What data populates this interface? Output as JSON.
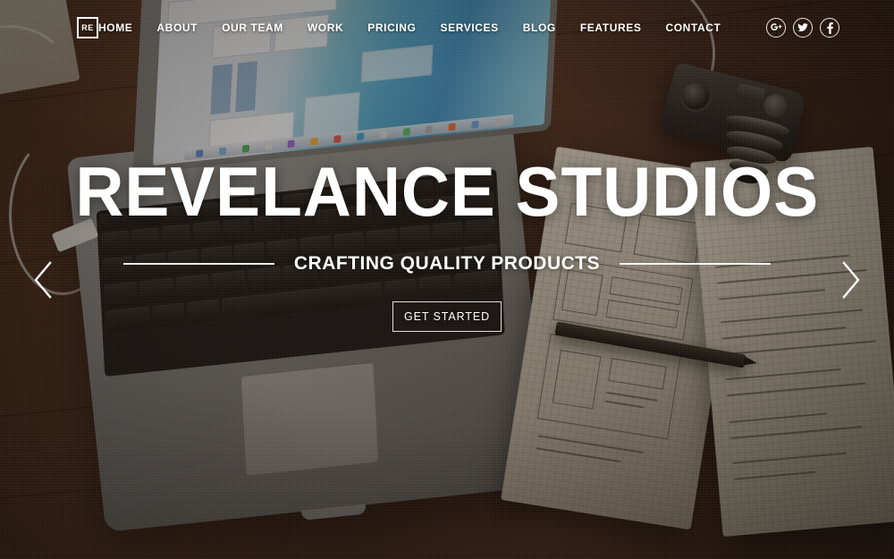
{
  "site": {
    "logo_text": "RE",
    "logo_name": "revelance-logo"
  },
  "nav": {
    "items": [
      {
        "label": "HOME",
        "name": "nav-home"
      },
      {
        "label": "ABOUT",
        "name": "nav-about"
      },
      {
        "label": "OUR TEAM",
        "name": "nav-our-team"
      },
      {
        "label": "WORK",
        "name": "nav-work"
      },
      {
        "label": "PRICING",
        "name": "nav-pricing"
      },
      {
        "label": "SERVICES",
        "name": "nav-services"
      },
      {
        "label": "BLOG",
        "name": "nav-blog"
      },
      {
        "label": "FEATURES",
        "name": "nav-features"
      },
      {
        "label": "CONTACT",
        "name": "nav-contact"
      }
    ]
  },
  "social": {
    "items": [
      {
        "name": "google-plus-icon",
        "glyph": "g+"
      },
      {
        "name": "twitter-icon",
        "glyph": "t"
      },
      {
        "name": "facebook-icon",
        "glyph": "f"
      }
    ]
  },
  "hero": {
    "title": "REVELANCE STUDIOS",
    "subtitle": "CRAFTING QUALITY PRODUCTS",
    "cta_label": "GET STARTED"
  },
  "carousel": {
    "prev_label": "Previous slide",
    "next_label": "Next slide"
  },
  "colors": {
    "text": "#ffffff",
    "desk_dark": "#3a2418",
    "desk_mid": "#5a3720",
    "screen_blue": "#4fa9cd",
    "laptop_silver": "#9a9a97"
  }
}
